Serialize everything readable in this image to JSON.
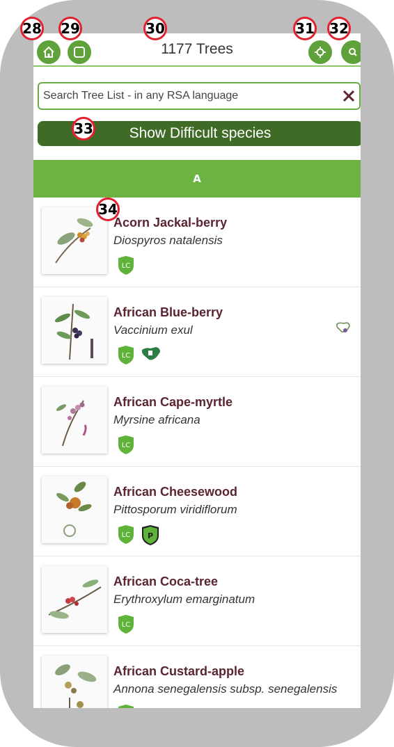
{
  "header": {
    "title": "1177 Trees"
  },
  "search": {
    "placeholder": "Search Tree List - in any RSA language",
    "value": ""
  },
  "difficult_button": {
    "label": "Show Difficult species"
  },
  "section": {
    "letter": "A"
  },
  "trees": [
    {
      "common": "Acorn Jackal-berry",
      "scientific": "Diospyros natalensis",
      "badges": [
        "LC"
      ]
    },
    {
      "common": "African Blue-berry",
      "scientific": "Vaccinium exul",
      "badges": [
        "LC",
        "endemic-map"
      ],
      "side_icon": "region-map-icon"
    },
    {
      "common": "African Cape-myrtle",
      "scientific": "Myrsine africana",
      "badges": [
        "LC"
      ]
    },
    {
      "common": "African Cheesewood",
      "scientific": "Pittosporum viridiflorum",
      "badges": [
        "LC",
        "P"
      ]
    },
    {
      "common": "African Coca-tree",
      "scientific": "Erythroxylum emarginatum",
      "badges": [
        "LC"
      ]
    },
    {
      "common": "African Custard-apple",
      "scientific": "Annona senegalensis subsp. senegalensis",
      "badges": [
        "LC"
      ]
    }
  ],
  "callouts": {
    "c28": "28",
    "c29": "29",
    "c30": "30",
    "c31": "31",
    "c32": "32",
    "c33": "33",
    "c34": "34"
  },
  "colors": {
    "primary_green": "#6cb344",
    "dark_green": "#3f6b27",
    "name_maroon": "#5a2430",
    "frame_gray": "#bdbdbd"
  }
}
